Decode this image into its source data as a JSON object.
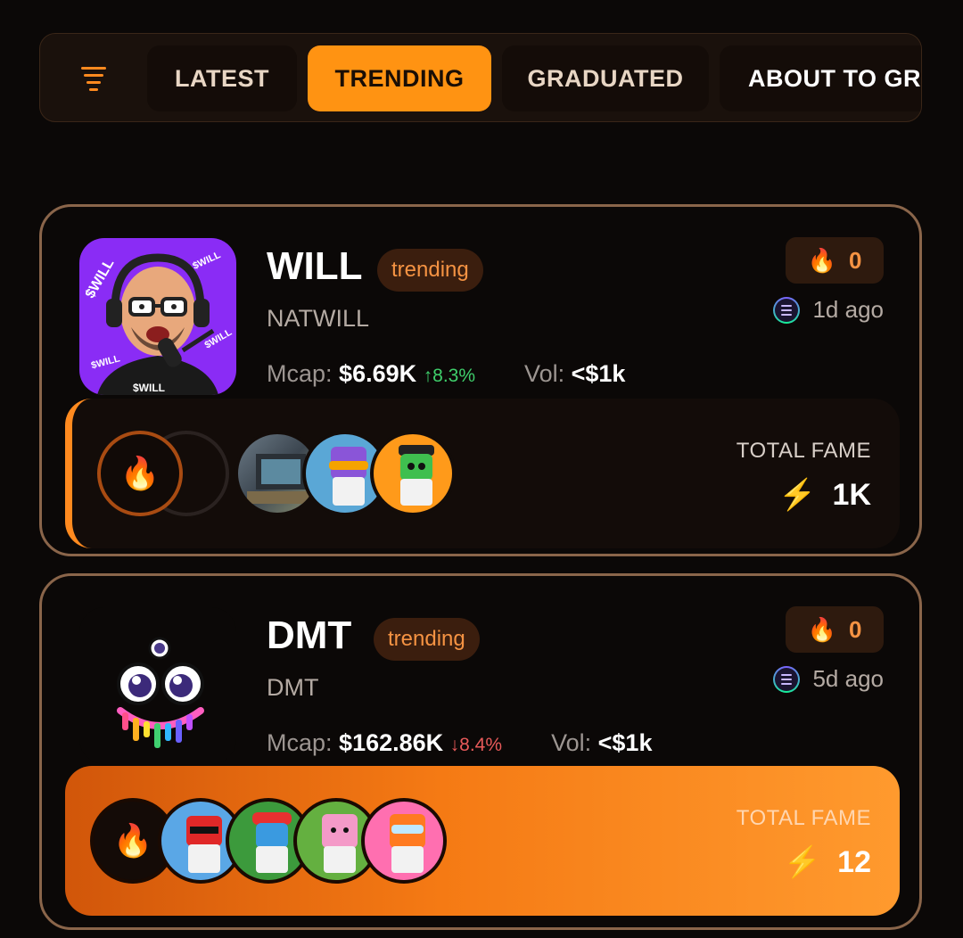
{
  "tabs": [
    {
      "label": "LATEST"
    },
    {
      "label": "TRENDING"
    },
    {
      "label": "GRADUATED"
    },
    {
      "label": "ABOUT TO GR"
    }
  ],
  "active_tab": "TRENDING",
  "tokens": [
    {
      "name": "WILL",
      "tag": "trending",
      "ticker": "NATWILL",
      "mcap_label": "Mcap:",
      "mcap": "$6.69K",
      "change": "↑8.3%",
      "vol_label": "Vol:",
      "vol": "<$1k",
      "fire_count": "0",
      "time": "1d ago",
      "fame_label": "TOTAL FAME",
      "fame": "1K",
      "avatar_text": "$WILL"
    },
    {
      "name": "DMT",
      "tag": "trending",
      "ticker": "DMT",
      "mcap_label": "Mcap:",
      "mcap": "$162.86K",
      "change": "↓8.4%",
      "vol_label": "Vol:",
      "vol": "<$1k",
      "fire_count": "0",
      "time": "5d ago",
      "fame_label": "TOTAL FAME",
      "fame": "12"
    }
  ],
  "icons": {
    "fire": "🔥",
    "bolt": "⚡"
  },
  "colors": {
    "accent": "#ff9312",
    "up": "#3fcf6b",
    "down": "#e85a5a",
    "card_border": "#8a654a"
  }
}
